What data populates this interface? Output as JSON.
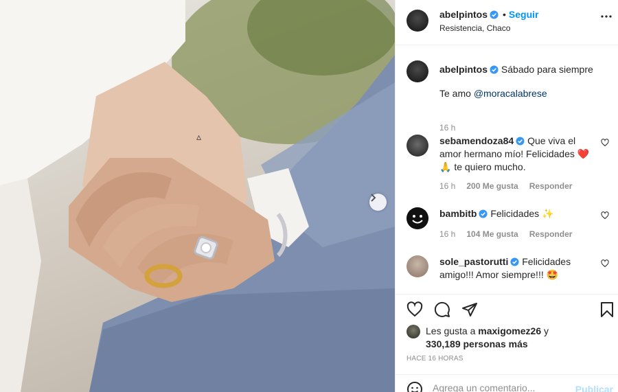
{
  "post": {
    "author": "abelpintos",
    "follow_label": "Seguir",
    "location": "Resistencia, Chaco"
  },
  "caption": {
    "username": "abelpintos",
    "line1": "Sábado para siempre",
    "line2_prefix": "Te amo ",
    "mention": "@moracalabrese",
    "time": "16 h"
  },
  "comments": [
    {
      "username": "sebamendoza84",
      "text_a": "Que viva el amor hermano mío! Felicidades ",
      "emoji": "❤️ 🙏",
      "text_b": " te quiero mucho.",
      "time": "16 h",
      "likes": "200 Me gusta",
      "reply": "Responder"
    },
    {
      "username": "bambitb",
      "text_a": "Felicidades ",
      "emoji": "✨",
      "text_b": "",
      "time": "16 h",
      "likes": "104 Me gusta",
      "reply": "Responder"
    },
    {
      "username": "sole_pastorutti",
      "text_a": "Felicidades amigo!!! Amor siempre!!! ",
      "emoji": "🤩",
      "text_b": "",
      "time": "",
      "likes": "",
      "reply": ""
    }
  ],
  "likes": {
    "prefix": "Les gusta a ",
    "user": "maxigomez26",
    "mid": " y",
    "count": "330,189 personas más"
  },
  "time_ago": "HACE 16 HORAS",
  "add_comment": {
    "placeholder": "Agrega un comentario...",
    "publish": "Publicar"
  },
  "icons": {
    "verified": "verified-badge-icon",
    "more": "more-options-icon",
    "heart": "heart-icon",
    "comment": "comment-icon",
    "share": "share-icon",
    "save": "bookmark-icon",
    "emoji": "emoji-icon",
    "next": "chevron-right-icon"
  },
  "colors": {
    "link": "#00376b",
    "accent": "#0095f6",
    "verified": "#3897f0"
  }
}
